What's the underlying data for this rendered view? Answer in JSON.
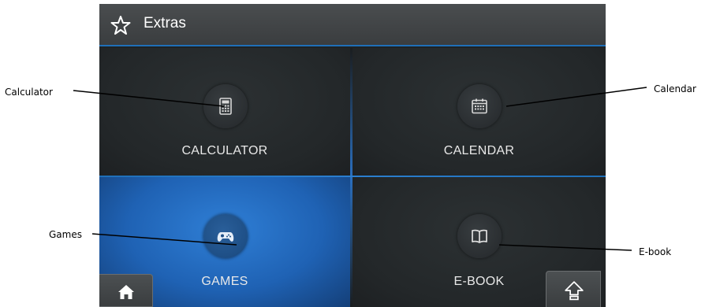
{
  "annotations": {
    "calculator": "Calculator",
    "calendar": "Calendar",
    "games": "Games",
    "ebook": "E-book"
  },
  "header": {
    "title": "Extras",
    "icon": "star-outline-icon"
  },
  "tiles": [
    {
      "label": "CALCULATOR",
      "icon": "calculator-icon",
      "active": false
    },
    {
      "label": "CALENDAR",
      "icon": "calendar-icon",
      "active": false
    },
    {
      "label": "GAMES",
      "icon": "gamepad-icon",
      "active": true
    },
    {
      "label": "E-BOOK",
      "icon": "open-book-icon",
      "active": false
    }
  ],
  "bottom_nav": {
    "left_icon": "home-icon",
    "right_icon": "up-arrow-icon"
  },
  "colors": {
    "accent": "#1f6fb8",
    "active_tile": "#1f62b4",
    "background": "#1e2224",
    "text": "#ffffff"
  }
}
